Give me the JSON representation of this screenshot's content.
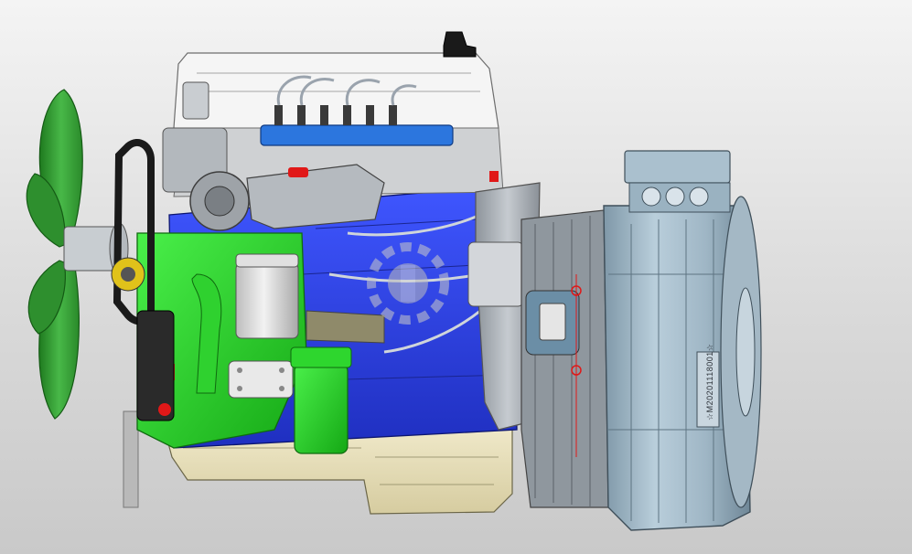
{
  "scene": {
    "description_kind": "3d-cad-render",
    "motor_plate": {
      "serial_text": "☆M20201118001☆"
    },
    "colors": {
      "background": "#dcdcdc",
      "block_blue": "#2a3fe0",
      "accessory_green": "#22cc22",
      "fan_green": "#2f9a2f",
      "motor_steel": "#a9c0cf",
      "head_white": "#f3f3f3",
      "oil_pan": "#e7dfb9",
      "rail_blue": "#2a6fd8",
      "accent_red": "#e01818",
      "housing_grey": "#b7bcc2"
    }
  }
}
